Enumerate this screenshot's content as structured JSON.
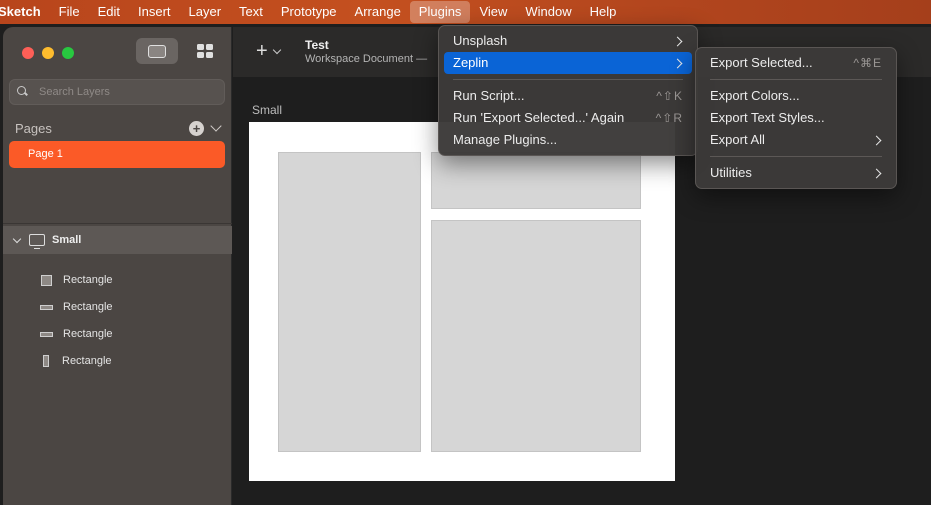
{
  "menubar": {
    "app": "Sketch",
    "items": [
      "File",
      "Edit",
      "Insert",
      "Layer",
      "Text",
      "Prototype",
      "Arrange",
      "Plugins",
      "View",
      "Window",
      "Help"
    ],
    "active": "Plugins"
  },
  "sidebar": {
    "search_placeholder": "Search Layers",
    "pages_title": "Pages",
    "pages": [
      "Page 1"
    ],
    "artboard": "Small",
    "layers": [
      "Rectangle",
      "Rectangle",
      "Rectangle",
      "Rectangle"
    ]
  },
  "toolbar": {
    "doc_title": "Test",
    "doc_subtitle": "Workspace Document —"
  },
  "canvas": {
    "artboard_label": "Small"
  },
  "plugins_menu": {
    "items": [
      {
        "label": "Unsplash",
        "submenu": true
      },
      {
        "label": "Zeplin",
        "submenu": true,
        "highlighted": true
      },
      {
        "label": "Run Script...",
        "shortcut": "^⇧K"
      },
      {
        "label": "Run 'Export Selected...' Again",
        "shortcut": "^⇧R"
      },
      {
        "label": "Manage Plugins..."
      }
    ]
  },
  "zeplin_menu": {
    "items": [
      {
        "label": "Export Selected...",
        "shortcut": "^⌘E"
      },
      {
        "label": "Export Colors..."
      },
      {
        "label": "Export Text Styles..."
      },
      {
        "label": "Export All",
        "submenu": true
      },
      {
        "label": "Utilities",
        "submenu": true
      }
    ]
  },
  "colors": {
    "accent": "#fb5a27",
    "menu_highlight": "#0a64d6",
    "menubar": "#c4501f"
  }
}
